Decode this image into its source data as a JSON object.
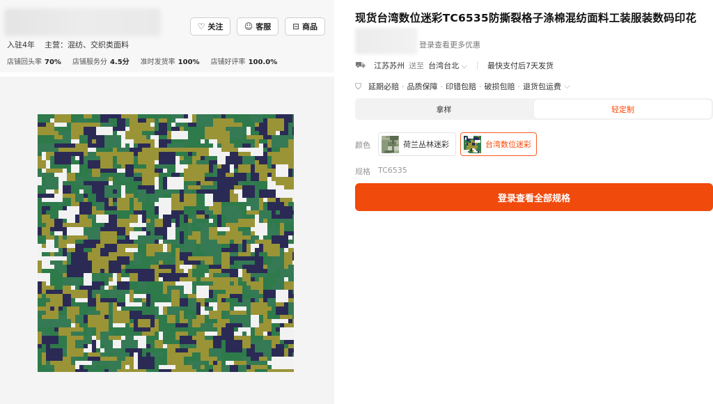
{
  "shop": {
    "follow_label": "关注",
    "service_label": "客服",
    "goods_label": "商品",
    "years": "入驻4年",
    "main_business": "主营：混纺、交织类面料",
    "stats": [
      {
        "label": "店铺回头率",
        "value": "70%"
      },
      {
        "label": "店铺服务分",
        "value": "4.5分"
      },
      {
        "label": "准时发货率",
        "value": "100%"
      },
      {
        "label": "店铺好评率",
        "value": "100.0%"
      }
    ]
  },
  "product": {
    "title": "现货台湾数位迷彩TC6535防撕裂格子涤棉混纺面料工装服装数码印花",
    "login_hint": "登录查看更多优惠",
    "ship_from": "江苏苏州",
    "ship_to_word": "送至",
    "ship_to": "台湾台北",
    "ship_time": "最快支付后7天发货",
    "services": [
      "延期必赔",
      "品质保障",
      "印错包赔",
      "破损包赔",
      "退货包运费"
    ],
    "modes": [
      "拿样",
      "轻定制"
    ],
    "color_label": "颜色",
    "colors": [
      "荷兰丛林迷彩",
      "台湾数位迷彩"
    ],
    "spec_label": "规格",
    "spec_value": "TC6535",
    "cta_label": "登录查看全部规格"
  },
  "colors": {
    "accent": "#ff4400",
    "cta_bg": "#f04a0c",
    "camo": [
      "#2e7a4a",
      "#9a9437",
      "#2a2a55",
      "#f2f2f2",
      "#357a55"
    ]
  }
}
